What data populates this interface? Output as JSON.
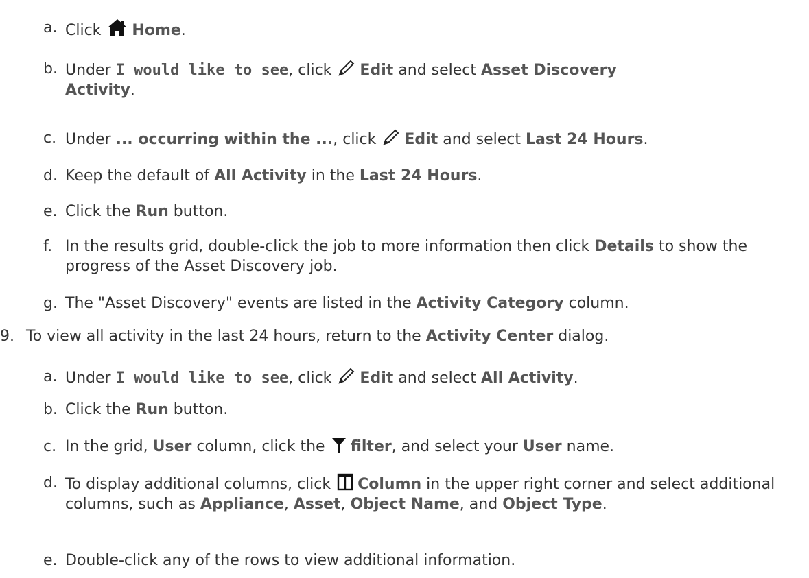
{
  "steps": {
    "s8a": {
      "label": "a.",
      "t1": "Click",
      "home": "Home",
      "end": "."
    },
    "s8b": {
      "label": "b.",
      "t1": "Under",
      "b1": "I would like to see",
      "t2": ", click",
      "edit": "Edit",
      "t3": "and select",
      "b2": "Asset Discovery  Activity",
      "end": "."
    },
    "s8c": {
      "label": "c.",
      "t1": "Under",
      "b1": "... occurring within the ...",
      "t2": ", click",
      "edit": "Edit",
      "t3": "and select",
      "b2": "Last 24 Hours",
      "end": "."
    },
    "s8d": {
      "label": "d.",
      "t1": "Keep the default of",
      "b1": "All Activity",
      "t2": "in the",
      "b2": "Last 24 Hours",
      "end": "."
    },
    "s8e": {
      "label": "e.",
      "t1": "Click the",
      "b1": "Run",
      "t2": "button."
    },
    "s8f": {
      "label": "f.",
      "t1": "In the results grid, double-click the job to more information then click",
      "b1": "Details",
      "t2": "to show the progress of the Asset Discovery job."
    },
    "s8g": {
      "label": "g.",
      "t1": "The \"Asset Discovery\" events are listed in the",
      "b1": "Activity Category",
      "t2": "column."
    },
    "s9": {
      "label": "9.",
      "t1": "To view all activity in the last 24 hours, return to the",
      "b1": "Activity Center",
      "t2": "dialog."
    },
    "s9a": {
      "label": "a.",
      "t1": "Under",
      "b1": "I would like to see",
      "t2": ", click",
      "edit": "Edit",
      "t3": "and select",
      "b2": "All Activity",
      "end": "."
    },
    "s9b": {
      "label": "b.",
      "t1": "Click the",
      "b1": "Run",
      "t2": "button."
    },
    "s9c": {
      "label": "c.",
      "t1": "In the grid,",
      "b1": "User",
      "t2": "column, click the",
      "filter": "filter",
      "t3": ", and select your",
      "b2": "User",
      "t4": "name."
    },
    "s9d": {
      "label": "d.",
      "t1": "To display additional columns, click",
      "column": "Column",
      "t2": "in the upper right corner and select additional columns, such as",
      "b1": "Appliance",
      "c1": ",",
      "b2": "Asset",
      "c2": ",",
      "b3": "Object Name",
      "c3": ", and",
      "b4": "Object Type",
      "end": "."
    },
    "s9e": {
      "label": "e.",
      "t1": "Double-click any of the rows to view additional information."
    }
  },
  "icons": {
    "home": "home-icon",
    "edit": "pencil-icon",
    "filter": "filter-icon",
    "column": "column-icon"
  }
}
